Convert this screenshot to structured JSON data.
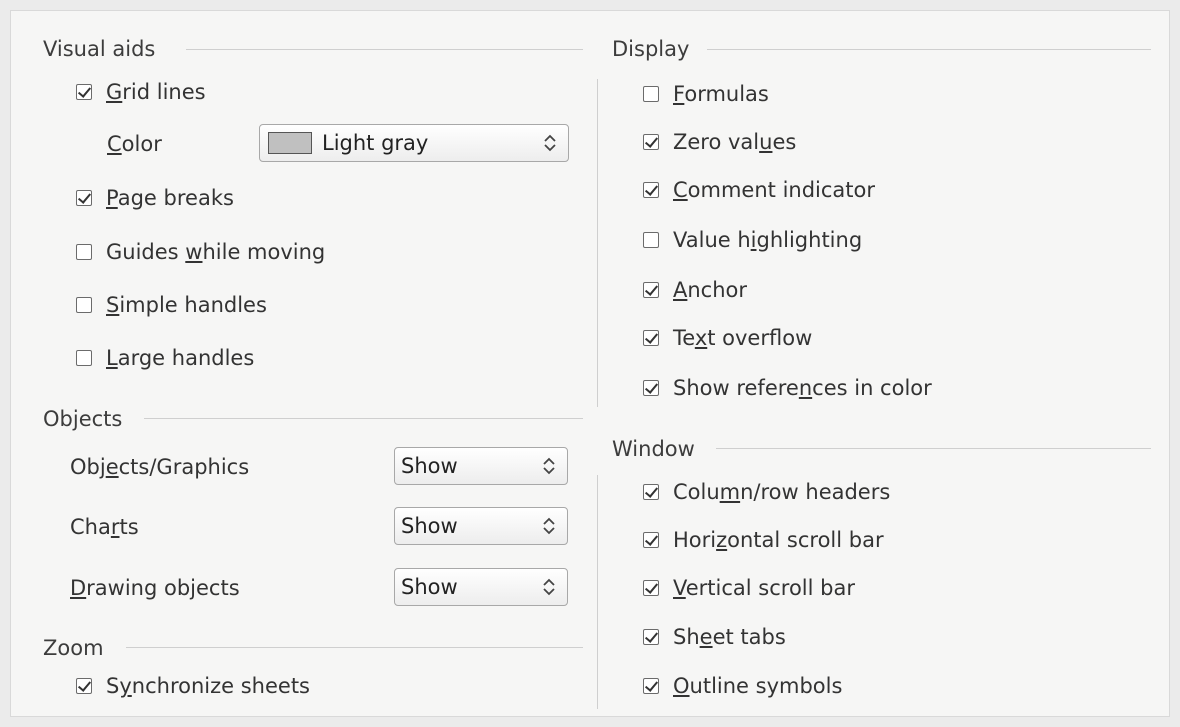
{
  "visual_aids": {
    "title": "Visual aids",
    "grid_lines": {
      "label_pre": "",
      "label_key": "G",
      "label_post": "rid lines",
      "checked": true
    },
    "color": {
      "label_pre": "",
      "label_key": "C",
      "label_post": "olor",
      "value": "Light gray",
      "swatch_color": "#c0c0c0"
    },
    "page_breaks": {
      "label_pre": "",
      "label_key": "P",
      "label_post": "age breaks",
      "checked": true
    },
    "guides": {
      "label_pre": "Guides ",
      "label_key": "w",
      "label_post": "hile moving",
      "checked": false
    },
    "simple_handles": {
      "label_pre": "",
      "label_key": "S",
      "label_post": "imple handles",
      "checked": false
    },
    "large_handles": {
      "label_pre": "",
      "label_key": "L",
      "label_post": "arge handles",
      "checked": false
    }
  },
  "objects": {
    "title": "Objects",
    "graphics": {
      "label_pre": "Obj",
      "label_key": "e",
      "label_post": "cts/Graphics",
      "value": "Show"
    },
    "charts": {
      "label_pre": "Cha",
      "label_key": "r",
      "label_post": "ts",
      "value": "Show"
    },
    "drawing": {
      "label_pre": "",
      "label_key": "D",
      "label_post": "rawing objects",
      "value": "Show"
    }
  },
  "zoom": {
    "title": "Zoom",
    "sync": {
      "label_pre": "S",
      "label_key": "y",
      "label_post": "nchronize sheets",
      "checked": true
    }
  },
  "display": {
    "title": "Display",
    "formulas": {
      "label_pre": "",
      "label_key": "F",
      "label_post": "ormulas",
      "checked": false
    },
    "zero_values": {
      "label_pre": "Zero val",
      "label_key": "u",
      "label_post": "es",
      "checked": true
    },
    "comment": {
      "label_pre": "",
      "label_key": "C",
      "label_post": "omment indicator",
      "checked": true
    },
    "value_highlighting": {
      "label_pre": "Value h",
      "label_key": "i",
      "label_post": "ghlighting",
      "checked": false
    },
    "anchor": {
      "label_pre": "",
      "label_key": "A",
      "label_post": "nchor",
      "checked": true
    },
    "text_overflow": {
      "label_pre": "Te",
      "label_key": "x",
      "label_post": "t overflow",
      "checked": true
    },
    "references": {
      "label_pre": "Show refere",
      "label_key": "n",
      "label_post": "ces in color",
      "checked": true
    }
  },
  "window": {
    "title": "Window",
    "headers": {
      "label_pre": "Colu",
      "label_key": "m",
      "label_post": "n/row headers",
      "checked": true
    },
    "hscroll": {
      "label_pre": "Hori",
      "label_key": "z",
      "label_post": "ontal scroll bar",
      "checked": true
    },
    "vscroll": {
      "label_pre": "",
      "label_key": "V",
      "label_post": "ertical scroll bar",
      "checked": true
    },
    "sheet_tabs": {
      "label_pre": "Sh",
      "label_key": "e",
      "label_post": "et tabs",
      "checked": true
    },
    "outline": {
      "label_pre": "",
      "label_key": "O",
      "label_post": "utline symbols",
      "checked": true
    }
  }
}
